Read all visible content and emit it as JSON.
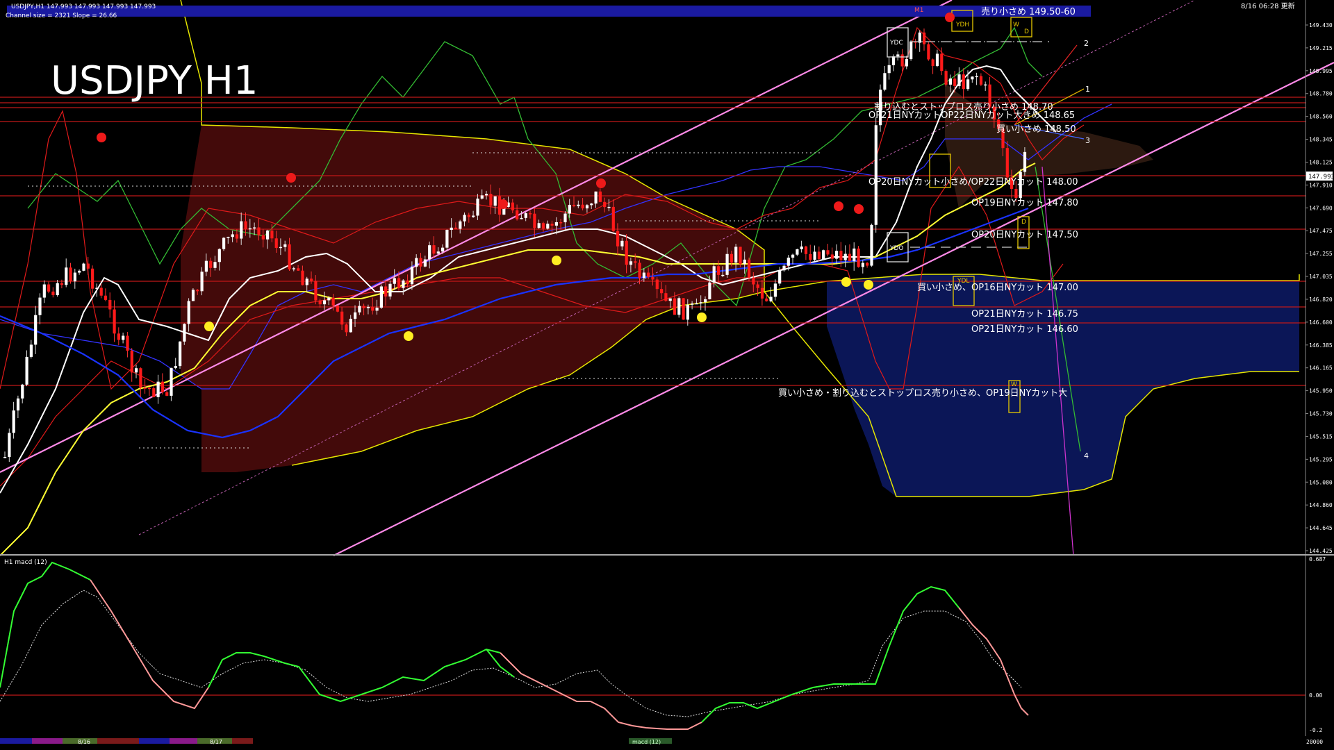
{
  "header": {
    "symbol_info": "USDJPY,H1   147.993 147.993 147.993 147.993",
    "channel_info": "Channel size = 2321 Slope = 26.66",
    "timestamp": "8/16 06:28 更新",
    "big_title": "USDJPY H1",
    "sell_banner": "売り小さめ 149.50-60"
  },
  "colors": {
    "background": "#000000",
    "bull_candle": "#ffffff",
    "bear_candle": "#ff1a1a",
    "channel": "#ff7fe0",
    "ma_white": "#ffffff",
    "ma_yellow": "#ffff33",
    "ma_blue": "#1a33ff",
    "bollinger": "#ff2020",
    "chikou_green": "#33cc33",
    "cloud_red": "#8a1a1a",
    "cloud_blue": "#1a2a8a",
    "macd_up": "#33ff33",
    "macd_down": "#ff9999",
    "banner": "#1a1aa0",
    "hline": "#c01818"
  },
  "price_axis": {
    "ticks": [
      "149.430",
      "149.215",
      "148.995",
      "148.780",
      "148.560",
      "148.345",
      "148.125",
      "147.910",
      "147.690",
      "147.475",
      "147.255",
      "147.035",
      "146.820",
      "146.600",
      "146.385",
      "146.165",
      "145.950",
      "145.730",
      "145.515",
      "145.295",
      "145.080",
      "144.860",
      "144.645",
      "144.425"
    ],
    "current": "147.993"
  },
  "annotations": {
    "l1": "割り込むとストップロス売り小さめ 148.70",
    "l2": "OP21日NYカットOP22日NYカット大きめ 148.65",
    "l3": "買い小さめ 148.50",
    "l4": "OP20日NYカット小さめ/OP22日NYカット 148.00",
    "l5": "OP19日NYカット 147.80",
    "l6": "OP20日NYカット 147.50",
    "l7": "買い小さめ、OP16日NYカット 147.00",
    "l8": "OP21日NYカット 146.75",
    "l9": "OP21日NYカット 146.60",
    "l10": "買い小さめ・割り込むとストップロス売り小さめ、OP19日NYカット大"
  },
  "markers": {
    "ydc": "YDC",
    "ydh": "YDH",
    "ydo": "YDO",
    "ydl": "YDL",
    "d": "D",
    "w": "W",
    "n1": "1",
    "n2": "2",
    "n3": "3",
    "n4": "4",
    "m1": "M1"
  },
  "macd_panel": {
    "title": "H1  macd (12)",
    "ticks": [
      "0.687",
      "0.00",
      "-0.2"
    ]
  },
  "bottom_bar": {
    "date1": "8/16",
    "date2": "8/17",
    "macd_tab": "macd (12)",
    "right_num": "20000"
  }
}
